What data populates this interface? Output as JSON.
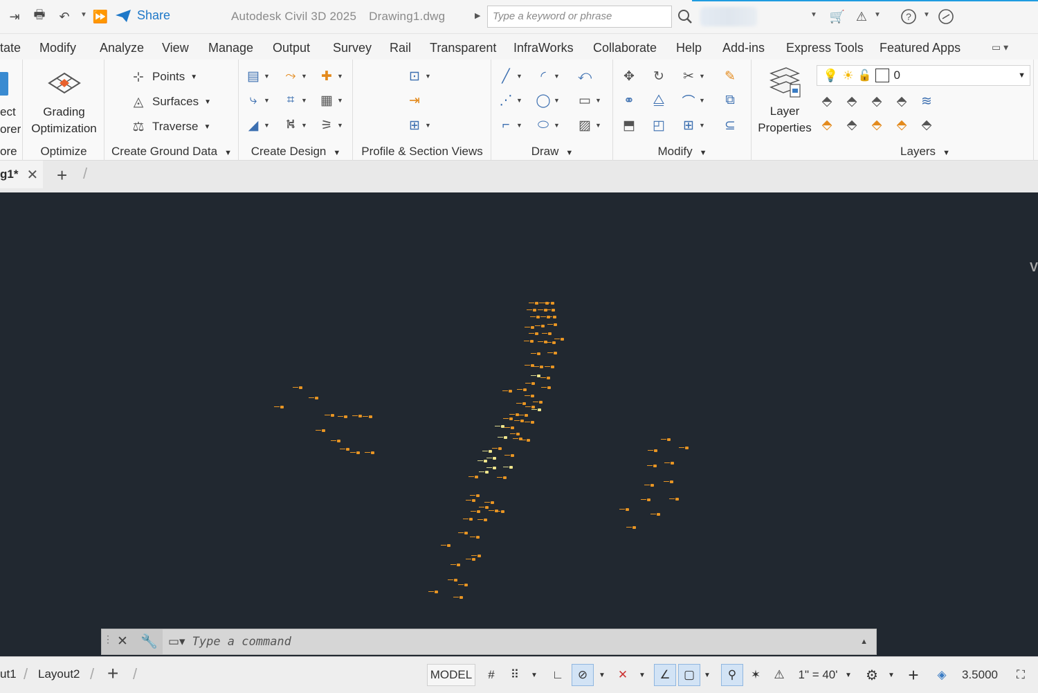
{
  "quick_access": {
    "share_label": "Share",
    "app_title": "Autodesk Civil 3D 2025",
    "file_name": "Drawing1.dwg",
    "search_placeholder": "Type a keyword or phrase"
  },
  "ribbon_tabs": [
    "tate",
    "Modify",
    "Analyze",
    "View",
    "Manage",
    "Output",
    "Survey",
    "Rail",
    "Transparent",
    "InfraWorks",
    "Collaborate",
    "Help",
    "Add-ins",
    "Express Tools",
    "Featured Apps"
  ],
  "panels": {
    "explore": {
      "line1": "ect",
      "line2": "orer",
      "label": "ore"
    },
    "optimize": {
      "button_line1": "Grading",
      "button_line2": "Optimization",
      "label": "Optimize"
    },
    "ground_data": {
      "points": "Points",
      "surfaces": "Surfaces",
      "traverse": "Traverse",
      "label": "Create Ground Data"
    },
    "design": {
      "label": "Create Design"
    },
    "profile": {
      "label": "Profile & Section Views"
    },
    "draw": {
      "label": "Draw"
    },
    "modify": {
      "label": "Modify"
    },
    "layers": {
      "button_line1": "Layer",
      "button_line2": "Properties",
      "current_layer": "0",
      "label": "Layers"
    }
  },
  "doc_tabs": {
    "active": "g1*"
  },
  "command_line": {
    "placeholder": "Type a command"
  },
  "status_bar": {
    "layout_tabs": [
      "ut1",
      "Layout2"
    ],
    "model_label": "MODEL",
    "scale": "1\" = 40'",
    "value": "3.5000"
  },
  "colors": {
    "canvas": "#212830",
    "point_marker": "#e89523",
    "accent": "#1e78c8"
  }
}
